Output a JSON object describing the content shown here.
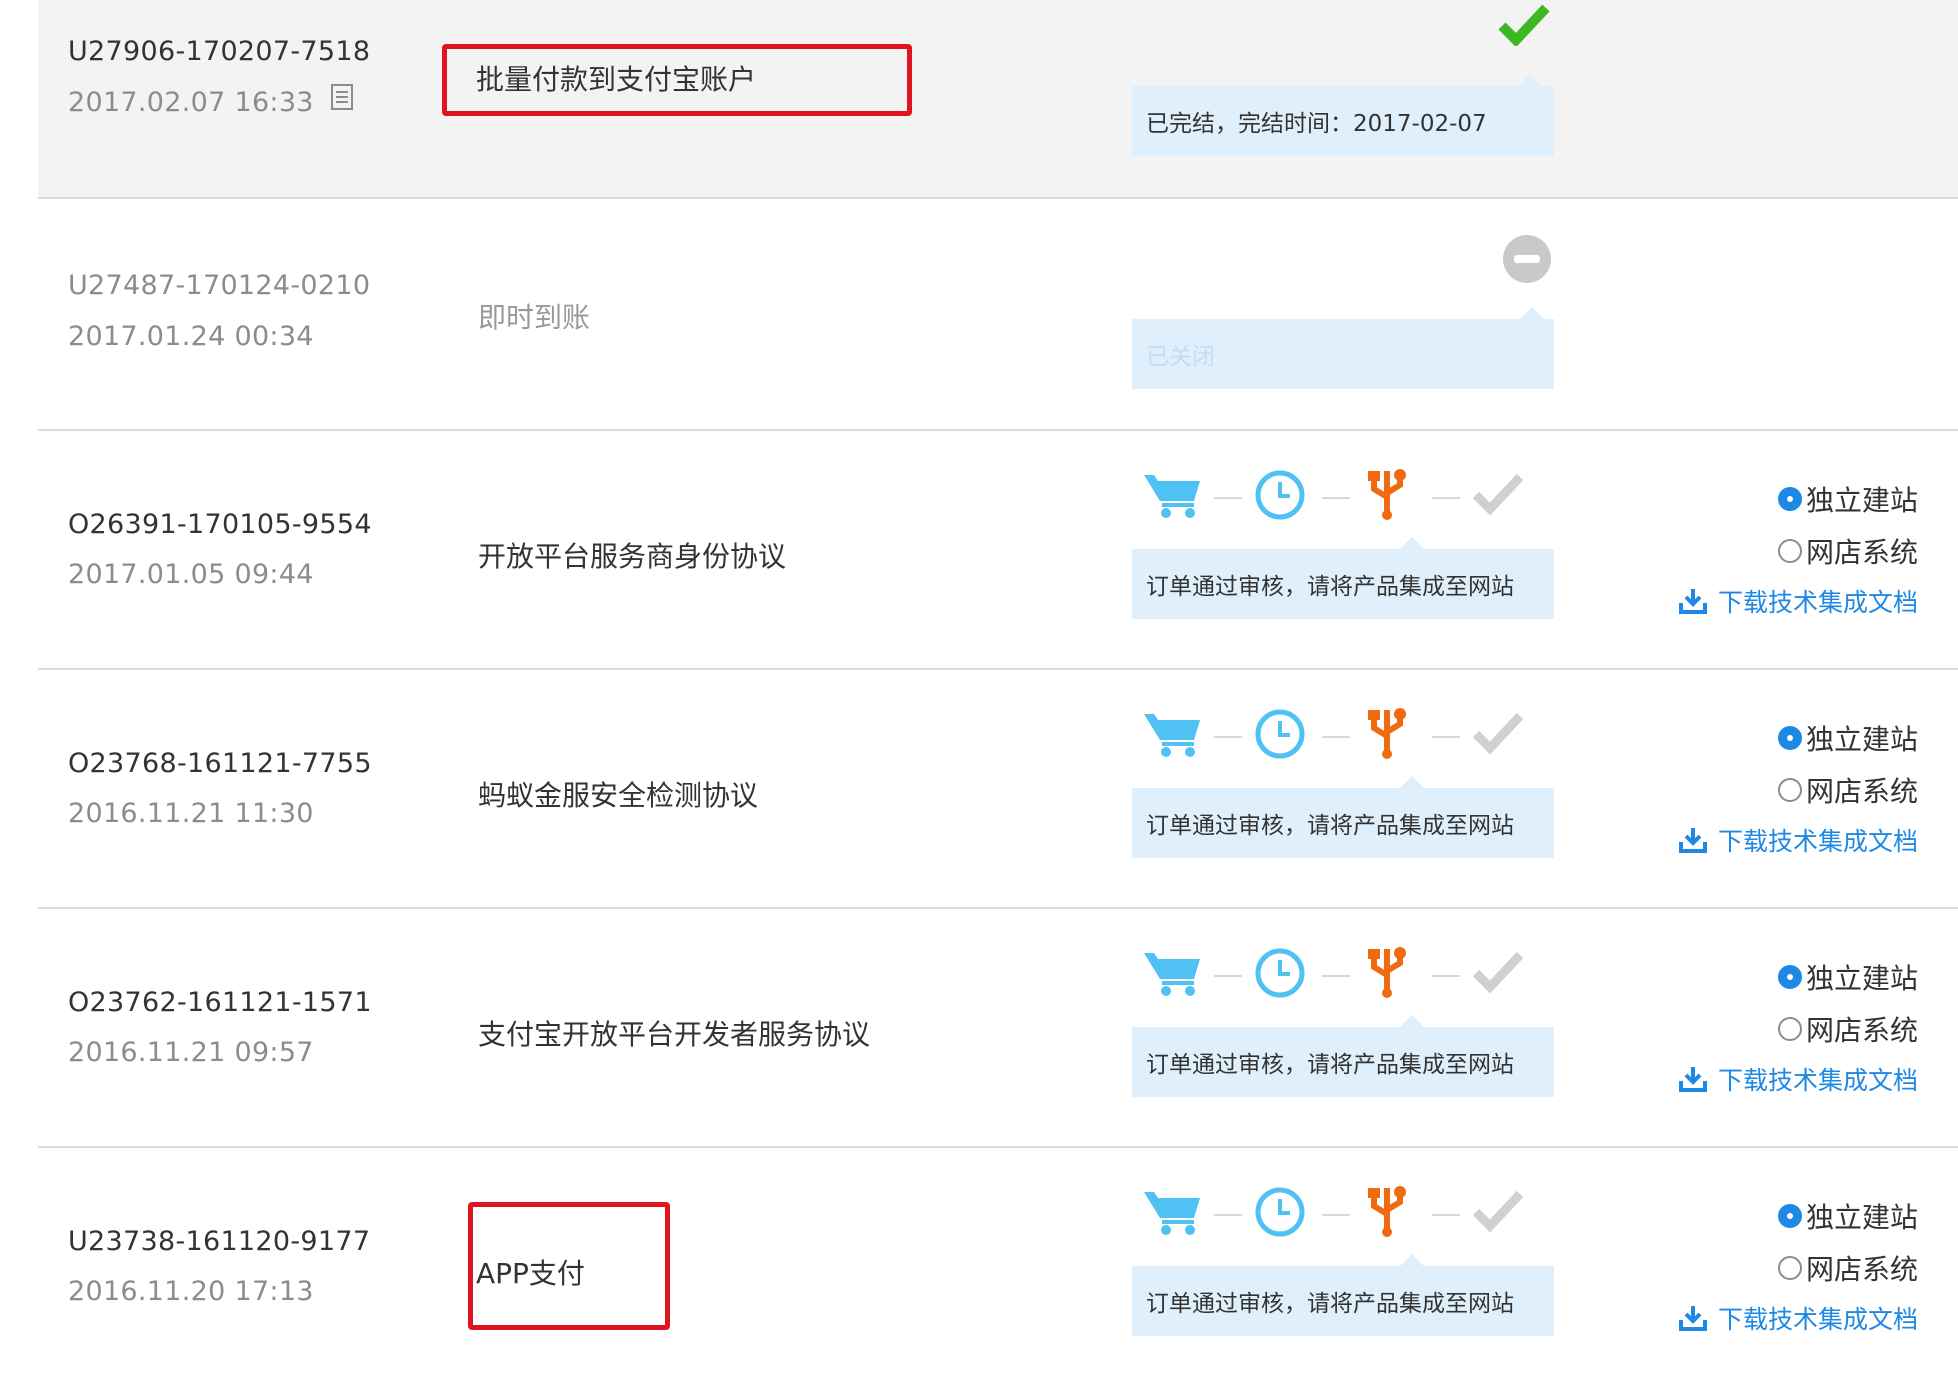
{
  "colors": {
    "accent": "#1e88e5",
    "done": "#3cb824",
    "highlight": "#e0141e",
    "state_bg": "#dff0fc",
    "usb": "#f06a0f"
  },
  "orders": [
    {
      "id": "U27906-170207-7518",
      "time": "2017.02.07 16:33",
      "product": "批量付款到支付宝账户",
      "highlighted": true,
      "state": "completed",
      "state_icon": "check-icon",
      "state_text": "已完结，完结时间：2017-02-07"
    },
    {
      "id": "U27487-170124-0210",
      "time": "2017.01.24 00:34",
      "product": "即时到账",
      "highlighted": false,
      "state": "closed",
      "state_icon": "minus-circle-icon",
      "state_text": "已关闭"
    },
    {
      "id": "O26391-170105-9554",
      "time": "2017.01.05 09:44",
      "product": "开放平台服务商身份协议",
      "highlighted": false,
      "state": "in-progress",
      "steps": [
        "cart-icon",
        "clock-icon",
        "usb-icon",
        "check-icon"
      ],
      "active_step": 3,
      "state_text": "订单通过审核，请将产品集成至网站",
      "options": [
        "独立建站",
        "网店系统"
      ],
      "selected_option": 1,
      "download_label": "下载技术集成文档"
    },
    {
      "id": "O23768-161121-7755",
      "time": "2016.11.21 11:30",
      "product": "蚂蚁金服安全检测协议",
      "highlighted": false,
      "state": "in-progress",
      "steps": [
        "cart-icon",
        "clock-icon",
        "usb-icon",
        "check-icon"
      ],
      "active_step": 3,
      "state_text": "订单通过审核，请将产品集成至网站",
      "options": [
        "独立建站",
        "网店系统"
      ],
      "selected_option": 1,
      "download_label": "下载技术集成文档"
    },
    {
      "id": "O23762-161121-1571",
      "time": "2016.11.21 09:57",
      "product": "支付宝开放平台开发者服务协议",
      "highlighted": false,
      "state": "in-progress",
      "steps": [
        "cart-icon",
        "clock-icon",
        "usb-icon",
        "check-icon"
      ],
      "active_step": 3,
      "state_text": "订单通过审核，请将产品集成至网站",
      "options": [
        "独立建站",
        "网店系统"
      ],
      "selected_option": 1,
      "download_label": "下载技术集成文档"
    },
    {
      "id": "U23738-161120-9177",
      "time": "2016.11.20 17:13",
      "product": "APP支付",
      "highlighted": true,
      "state": "in-progress",
      "steps": [
        "cart-icon",
        "clock-icon",
        "usb-icon",
        "check-icon"
      ],
      "active_step": 3,
      "state_text": "订单通过审核，请将产品集成至网站",
      "options": [
        "独立建站",
        "网店系统"
      ],
      "selected_option": 1,
      "download_label": "下载技术集成文档"
    }
  ]
}
